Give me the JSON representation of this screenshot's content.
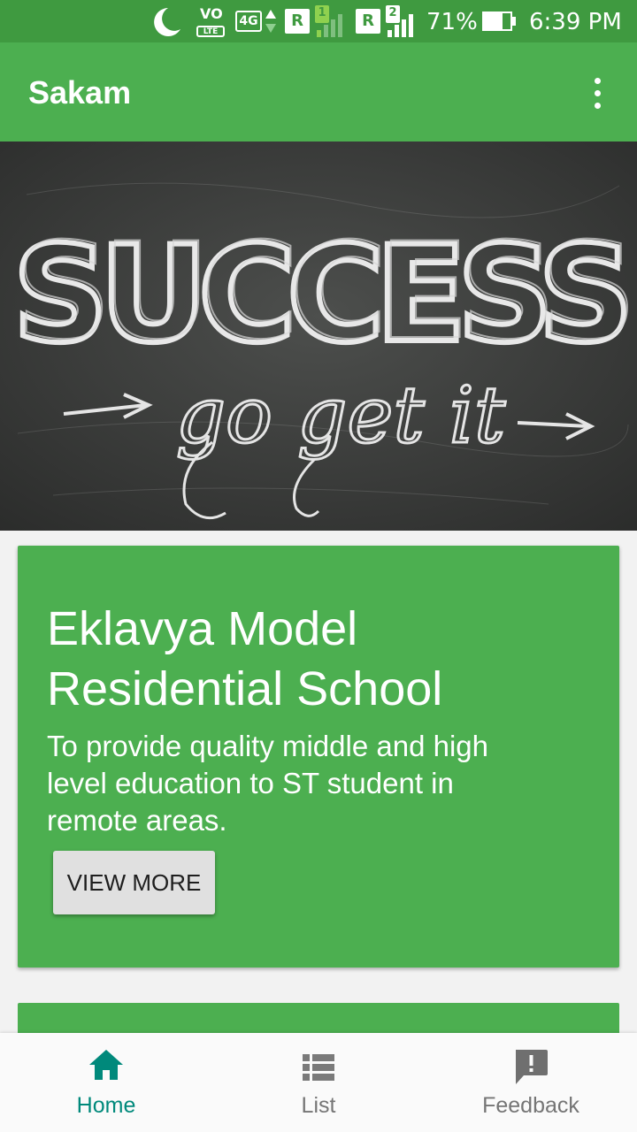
{
  "status_bar": {
    "volte_top": "VO",
    "volte_bottom": "LTE",
    "network": "4G",
    "sim1_badge": "R",
    "sim1_number": "1",
    "sim2_badge": "R",
    "sim2_number": "2",
    "battery_percent": "71%",
    "battery_level": 0.71,
    "time": "6:39 PM"
  },
  "app_bar": {
    "title": "Sakam",
    "overflow_icon": "more-vert-icon"
  },
  "banner": {
    "image_text_main": "SUCCESS",
    "image_text_sub": "go get it",
    "slide_count": 2,
    "active_slide": 1
  },
  "card": {
    "title_line1": "Eklavya Model",
    "title_line2": "Residential School",
    "description_line1": "To provide quality middle and high",
    "description_line2": "level education to ST student in",
    "description_line3": "remote areas.",
    "button_label": "VIEW MORE"
  },
  "bottom_nav": {
    "items": [
      {
        "label": "Home",
        "icon": "home-icon",
        "active": true
      },
      {
        "label": "List",
        "icon": "list-icon",
        "active": false
      },
      {
        "label": "Feedback",
        "icon": "feedback-icon",
        "active": false
      }
    ]
  },
  "colors": {
    "primary": "#4caf50",
    "primary_dark": "#3f9a40",
    "accent": "#00897b",
    "nav_inactive": "#757575"
  }
}
